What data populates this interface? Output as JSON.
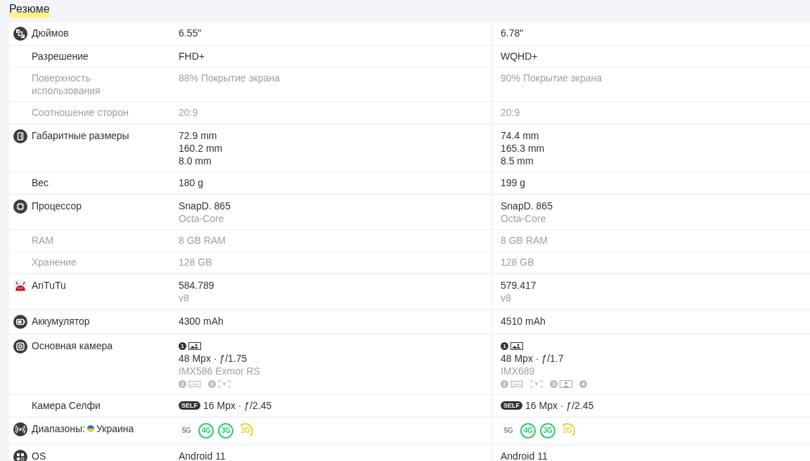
{
  "title": "Резюме",
  "rows": [
    {
      "label": "Дюймов",
      "kind": "screen",
      "group_start": true,
      "muted": false,
      "cells": [
        [
          {
            "kind": "text",
            "text": "6.55\"",
            "muted": false
          }
        ],
        [
          {
            "kind": "text",
            "text": "6.78\"",
            "muted": false
          }
        ]
      ]
    },
    {
      "label": "Разрешение",
      "muted": false,
      "cells": [
        [
          {
            "kind": "text",
            "text": "FHD+",
            "muted": false
          }
        ],
        [
          {
            "kind": "text",
            "text": "WQHD+",
            "muted": false
          }
        ]
      ]
    },
    {
      "label": "Поверхность использования",
      "muted": true,
      "cells": [
        [
          {
            "kind": "text",
            "text": "88% Покрытие экрана",
            "muted": true
          }
        ],
        [
          {
            "kind": "text",
            "text": "90% Покрытие экрана",
            "muted": true
          }
        ]
      ]
    },
    {
      "label": "Соотношение сторон",
      "muted": true,
      "cells": [
        [
          {
            "kind": "text",
            "text": "20:9",
            "muted": true
          }
        ],
        [
          {
            "kind": "text",
            "text": "20:9",
            "muted": true
          }
        ]
      ]
    },
    {
      "label": "Габаритные размеры",
      "kind": "phone",
      "group_start": true,
      "muted": false,
      "cells": [
        [
          {
            "kind": "text",
            "text": "72.9 mm",
            "muted": false
          },
          {
            "kind": "text",
            "text": "160.2 mm",
            "muted": false
          },
          {
            "kind": "text",
            "text": "8.0 mm",
            "muted": false
          }
        ],
        [
          {
            "kind": "text",
            "text": "74.4 mm",
            "muted": false
          },
          {
            "kind": "text",
            "text": "165.3 mm",
            "muted": false
          },
          {
            "kind": "text",
            "text": "8.5 mm",
            "muted": false
          }
        ]
      ]
    },
    {
      "label": "Вес",
      "muted": false,
      "cells": [
        [
          {
            "kind": "text",
            "text": "180 g",
            "muted": false
          }
        ],
        [
          {
            "kind": "text",
            "text": "199 g",
            "muted": false
          }
        ]
      ]
    },
    {
      "label": "Процессор",
      "kind": "chip",
      "group_start": true,
      "muted": false,
      "cells": [
        [
          {
            "kind": "text",
            "text": "SnapD. 865",
            "muted": false
          },
          {
            "kind": "text",
            "text": "Octa-Core",
            "muted": true
          }
        ],
        [
          {
            "kind": "text",
            "text": "SnapD. 865",
            "muted": false
          },
          {
            "kind": "text",
            "text": "Octa-Core",
            "muted": true
          }
        ]
      ]
    },
    {
      "label": "RAM",
      "muted": true,
      "cells": [
        [
          {
            "kind": "text",
            "text": "8 GB RAM",
            "muted": true
          }
        ],
        [
          {
            "kind": "text",
            "text": "8 GB RAM",
            "muted": true
          }
        ]
      ]
    },
    {
      "label": "Хранение",
      "muted": true,
      "cells": [
        [
          {
            "kind": "text",
            "text": "128 GB",
            "muted": true
          }
        ],
        [
          {
            "kind": "text",
            "text": "128 GB",
            "muted": true
          }
        ]
      ]
    },
    {
      "label": "AnTuTu",
      "kind": "antutu",
      "group_start": true,
      "muted": false,
      "cells": [
        [
          {
            "kind": "text",
            "text": "584.789",
            "muted": false
          },
          {
            "kind": "text",
            "text": "v8",
            "muted": true
          }
        ],
        [
          {
            "kind": "text",
            "text": "579.417",
            "muted": false
          },
          {
            "kind": "text",
            "text": "v8",
            "muted": true
          }
        ]
      ]
    },
    {
      "label": "Аккумулятор",
      "kind": "battery",
      "group_start": true,
      "muted": false,
      "cells": [
        [
          {
            "kind": "text",
            "text": "4300 mAh",
            "muted": false
          }
        ],
        [
          {
            "kind": "text",
            "text": "4510 mAh",
            "muted": false
          }
        ]
      ]
    },
    {
      "label": "Основная камера",
      "kind": "camera",
      "group_start": true,
      "muted": false,
      "cells": [
        [
          {
            "kind": "lenses",
            "muted": false,
            "lenses": [
              {
                "number": "1",
                "kind": "photo"
              }
            ]
          },
          {
            "kind": "text",
            "text": "48 Mpx · ƒ/1.75",
            "muted": false
          },
          {
            "kind": "text",
            "text": "IMX586 Exmor RS",
            "muted": true
          },
          {
            "kind": "lenses",
            "muted": true,
            "lenses": [
              {
                "number": "2",
                "kind": "wide"
              },
              {
                "number": "3",
                "kind": "macro"
              }
            ]
          }
        ],
        [
          {
            "kind": "lenses",
            "muted": false,
            "lenses": [
              {
                "number": "1",
                "kind": "photo"
              }
            ]
          },
          {
            "kind": "text",
            "text": "48 Mpx · ƒ/1.7",
            "muted": false
          },
          {
            "kind": "text",
            "text": "IMX689",
            "muted": true
          },
          {
            "kind": "lenses",
            "muted": true,
            "lenses": [
              {
                "number": "2",
                "kind": "wide"
              },
              {
                "kind": "macro"
              },
              {
                "number": "3",
                "kind": "portrait"
              },
              {
                "number": "4"
              }
            ]
          }
        ]
      ]
    },
    {
      "label": "Камера Селфи",
      "muted": false,
      "cells": [
        [
          {
            "kind": "badge",
            "badge": "SELF",
            "text": "16 Mpx · ƒ/2.45"
          }
        ],
        [
          {
            "kind": "badge",
            "badge": "SELF",
            "text": "16 Mpx · ƒ/2.45"
          }
        ]
      ]
    },
    {
      "label": "Диапазоны:",
      "region": "Украина",
      "kind": "signal",
      "group_start": true,
      "muted": false,
      "cells": [
        [
          {
            "kind": "bands",
            "bands": [
              {
                "label": "5G",
                "color": "#dddddd",
                "supported": false,
                "partial": false
              },
              {
                "label": "4G",
                "color": "#2ecc71",
                "supported": true,
                "partial": false
              },
              {
                "label": "3G",
                "color": "#2ecc71",
                "supported": true,
                "partial": false
              },
              {
                "label": "2G",
                "color": "#f2d22e",
                "supported": true,
                "partial": true
              }
            ]
          }
        ],
        [
          {
            "kind": "bands",
            "bands": [
              {
                "label": "5G",
                "color": "#dddddd",
                "supported": false,
                "partial": false
              },
              {
                "label": "4G",
                "color": "#2ecc71",
                "supported": true,
                "partial": false
              },
              {
                "label": "3G",
                "color": "#2ecc71",
                "supported": true,
                "partial": false
              },
              {
                "label": "2G",
                "color": "#f2d22e",
                "supported": true,
                "partial": true
              }
            ]
          }
        ]
      ]
    },
    {
      "label": "OS",
      "kind": "apps",
      "group_start": true,
      "muted": false,
      "cells": [
        [
          {
            "kind": "text",
            "text": "Android 11",
            "muted": false
          }
        ],
        [
          {
            "kind": "text",
            "text": "Android 11",
            "muted": false
          }
        ]
      ]
    }
  ]
}
